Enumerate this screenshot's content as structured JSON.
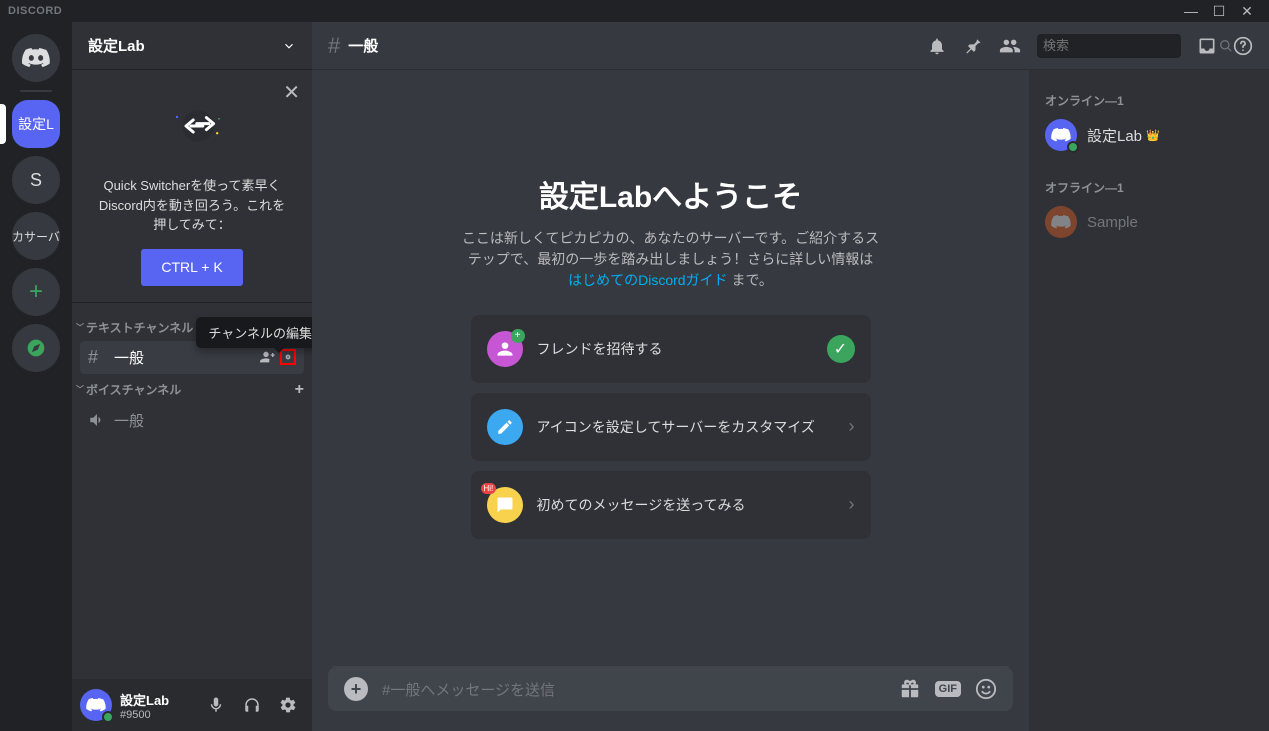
{
  "titlebar": {
    "logo": "DISCORD"
  },
  "guilds": {
    "selected_label": "設定L",
    "s_label": "S",
    "add_server_label": "カサーバ"
  },
  "server": {
    "name": "設定Lab"
  },
  "quick_switcher": {
    "text": "Quick Switcherを使って素早くDiscord内を動き回ろう。これを押してみて：",
    "button": "CTRL + K"
  },
  "categories": {
    "text": {
      "label": "テキストチャンネル"
    },
    "voice": {
      "label": "ボイスチャンネル"
    }
  },
  "channels": {
    "general_text": "一般",
    "general_voice": "一般"
  },
  "tooltip": {
    "edit_channel": "チャンネルの編集"
  },
  "user": {
    "name": "設定Lab",
    "tag": "#9500"
  },
  "channel_header": {
    "name": "一般",
    "search_placeholder": "検索"
  },
  "welcome": {
    "title": "設定Labへようこそ",
    "desc_pre": "ここは新しくてピカピカの、あなたのサーバーです。ご紹介するステップで、最初の一歩を踏み出しましょう！さらに詳しい情報は ",
    "desc_link": "はじめてのDiscordガイド",
    "desc_post": " まで。"
  },
  "onboarding": {
    "invite": "フレンドを招待する",
    "customize": "アイコンを設定してサーバーをカスタマイズ",
    "first_message": "初めてのメッセージを送ってみる"
  },
  "message_input": {
    "placeholder": "#一般へメッセージを送信",
    "gif": "GIF"
  },
  "members": {
    "online_header": "オンライン—1",
    "offline_header": "オフライン—1",
    "online": [
      {
        "name": "設定Lab",
        "owner": true
      }
    ],
    "offline": [
      {
        "name": "Sample"
      }
    ]
  }
}
